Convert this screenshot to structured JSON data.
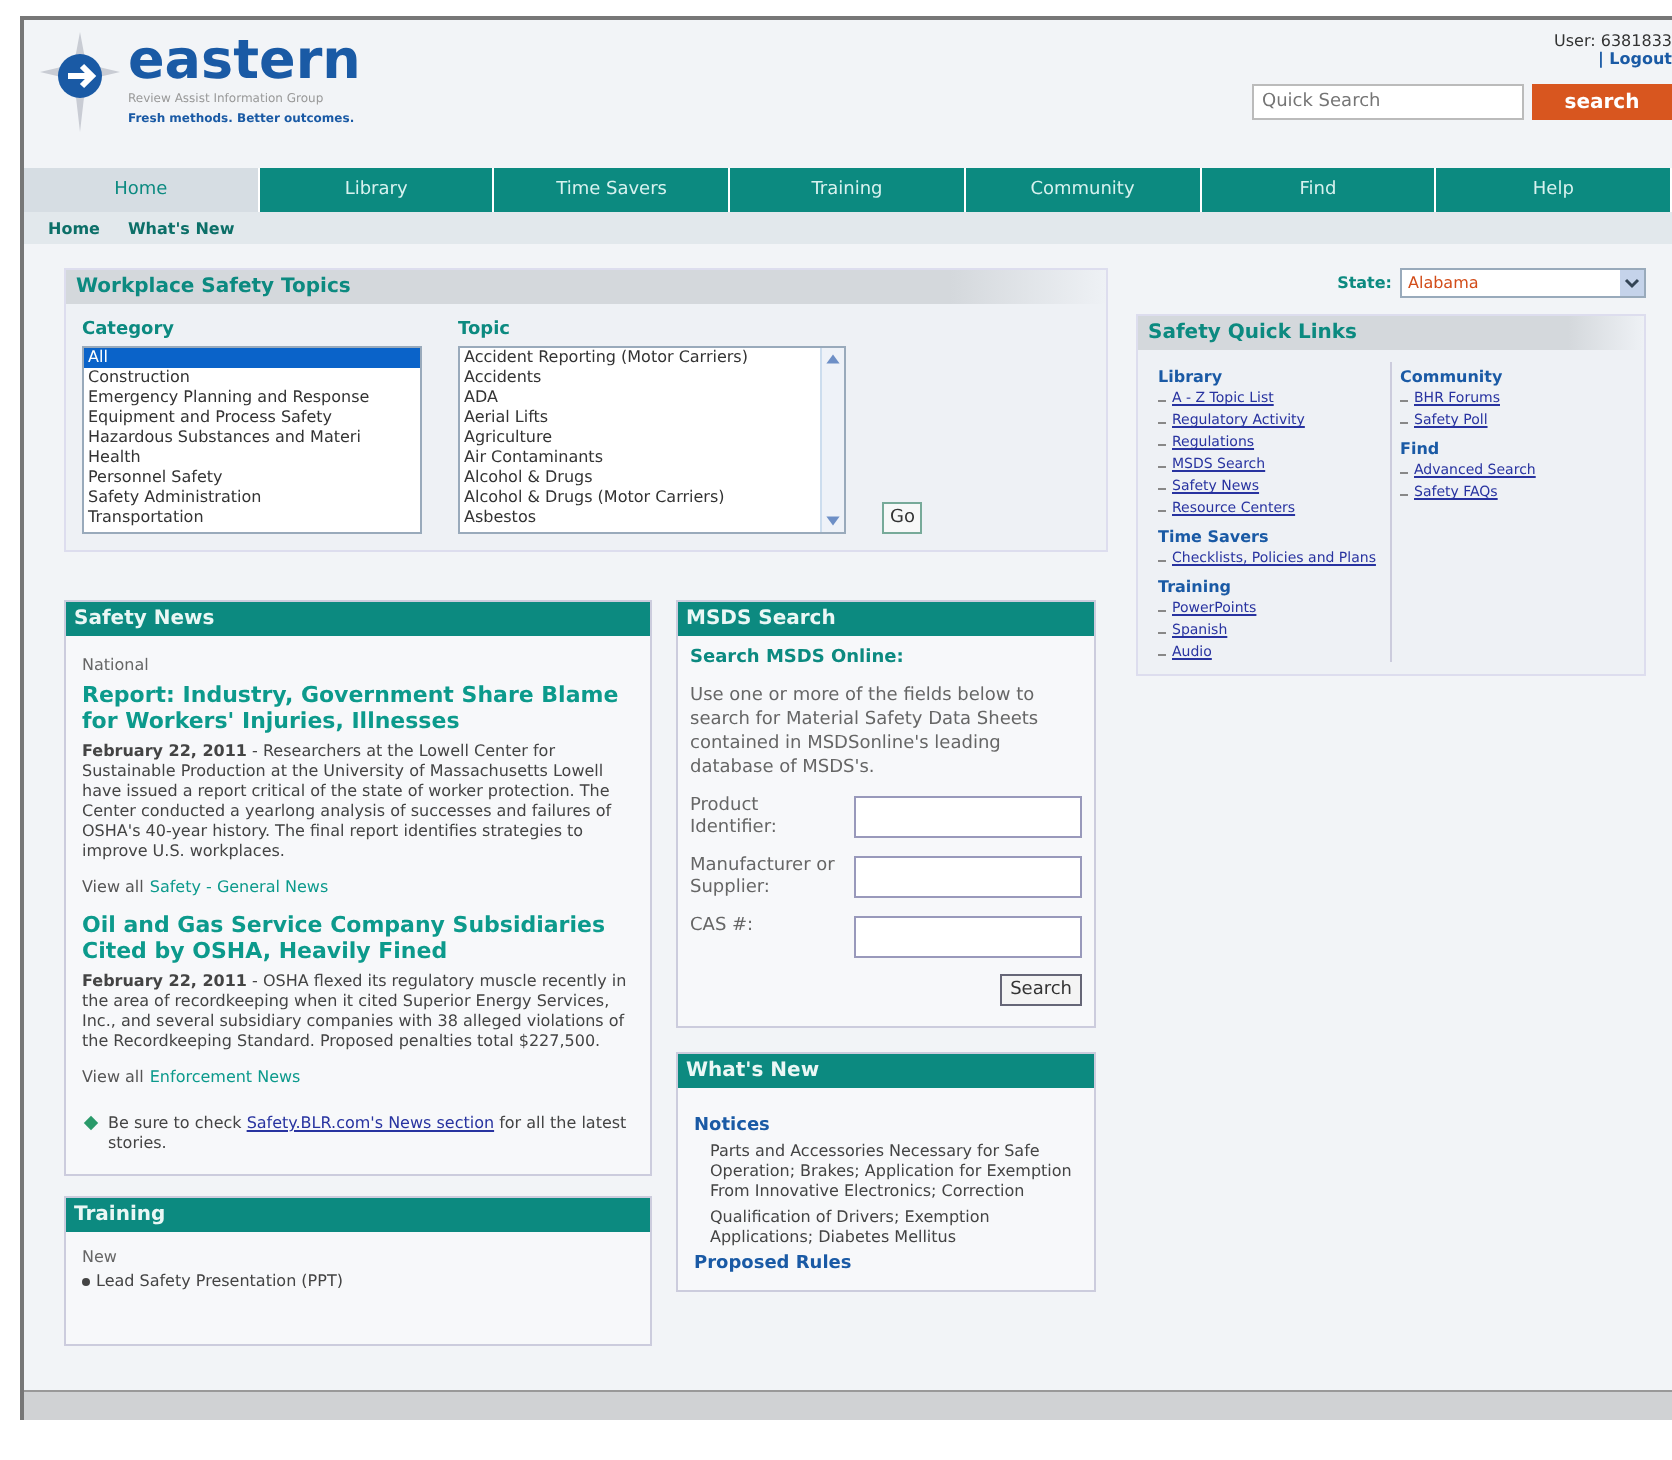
{
  "header": {
    "logo": "eastern",
    "tagline": "Review Assist Information Group",
    "slogan": "Fresh methods. Better outcomes.",
    "user": "User: 6381833",
    "logout": "| Logout",
    "search": {
      "placeholder": "Quick Search",
      "button": "search"
    }
  },
  "nav": [
    {
      "label": "Home",
      "selected": true
    },
    {
      "label": "Library",
      "selected": false
    },
    {
      "label": "Time Savers",
      "selected": false
    },
    {
      "label": "Training",
      "selected": false
    },
    {
      "label": "Community",
      "selected": false
    },
    {
      "label": "Find",
      "selected": false
    },
    {
      "label": "Help",
      "selected": false
    }
  ],
  "subnav": [
    "Home",
    "What's New"
  ],
  "topics": {
    "title": "Workplace Safety Topics",
    "category_label": "Category",
    "categories": [
      {
        "label": "All",
        "selected": true
      },
      {
        "label": "Construction",
        "selected": false
      },
      {
        "label": "Emergency Planning and Response",
        "selected": false
      },
      {
        "label": "Equipment and Process Safety",
        "selected": false
      },
      {
        "label": "Hazardous Substances and Materi",
        "selected": false
      },
      {
        "label": "Health",
        "selected": false
      },
      {
        "label": "Personnel Safety",
        "selected": false
      },
      {
        "label": "Safety Administration",
        "selected": false
      },
      {
        "label": "Transportation",
        "selected": false
      }
    ],
    "topic_label": "Topic",
    "topics": [
      "Accident Reporting (Motor Carriers)",
      "Accidents",
      "ADA",
      "Aerial Lifts",
      "Agriculture",
      "Air Contaminants",
      "Alcohol & Drugs",
      "Alcohol & Drugs (Motor Carriers)",
      "Asbestos"
    ],
    "go": "Go"
  },
  "state": {
    "label": "State:",
    "value": "Alabama"
  },
  "quick_links": {
    "title": "Safety Quick Links",
    "columns": [
      [
        {
          "heading": "Library",
          "links": [
            "A - Z Topic List",
            "Regulatory Activity",
            "Regulations",
            "MSDS Search",
            "Safety News",
            "Resource Centers"
          ]
        },
        {
          "heading": "Time Savers",
          "links": [
            "Checklists, Policies and Plans"
          ]
        },
        {
          "heading": "Training",
          "links": [
            "PowerPoints",
            "Spanish",
            "Audio"
          ]
        }
      ],
      [
        {
          "heading": "Community",
          "links": [
            "BHR Forums",
            "Safety Poll"
          ]
        },
        {
          "heading": "Find",
          "links": [
            "Advanced Search",
            "Safety FAQs"
          ]
        }
      ]
    ]
  },
  "safety_news": {
    "title": "Safety News",
    "section": "National",
    "stories": [
      {
        "headline": "Report: Industry, Government Share Blame for Workers' Injuries, Illnesses",
        "date": "February 22, 2011",
        "body": "- Researchers at the Lowell Center for Sustainable Production at the University of Massachusetts Lowell have issued a report critical of the state of worker protection. The Center conducted a yearlong analysis of successes and failures of OSHA's 40-year history. The final report identifies strategies to improve U.S. workplaces.",
        "view_all": "View all",
        "view_link": "Safety - General News"
      },
      {
        "headline": "Oil and Gas Service Company Subsidiaries Cited by OSHA, Heavily Fined",
        "date": "February 22, 2011",
        "body": "- OSHA flexed its regulatory muscle recently in the area of recordkeeping when it cited Superior Energy Services, Inc., and several subsidiary companies with 38 alleged violations of the Recordkeeping Standard. Proposed penalties total $227,500.",
        "view_all": "View all",
        "view_link": "Enforcement News"
      }
    ],
    "note_before": "Be sure to check",
    "note_link": "Safety.BLR.com's News section",
    "note_after": "for all the latest stories."
  },
  "training": {
    "title": "Training",
    "section": "New",
    "items": [
      "Lead Safety Presentation (PPT)"
    ]
  },
  "msds": {
    "title": "MSDS Search",
    "subtitle": "Search MSDS Online:",
    "intro": "Use one or more of the fields below to search for Material Safety Data Sheets contained in MSDSonline's leading database of MSDS's.",
    "fields": [
      "Product Identifier:",
      "Manufacturer or Supplier:",
      "CAS #:"
    ],
    "button": "Search"
  },
  "whats_new": {
    "title": "What's New",
    "groups": [
      {
        "heading": "Notices",
        "items": [
          "Parts and Accessories Necessary for Safe Operation; Brakes; Application for Exemption From Innovative Electronics; Correction",
          "Qualification of Drivers; Exemption Applications; Diabetes Mellitus"
        ]
      },
      {
        "heading": "Proposed Rules"
      }
    ]
  }
}
